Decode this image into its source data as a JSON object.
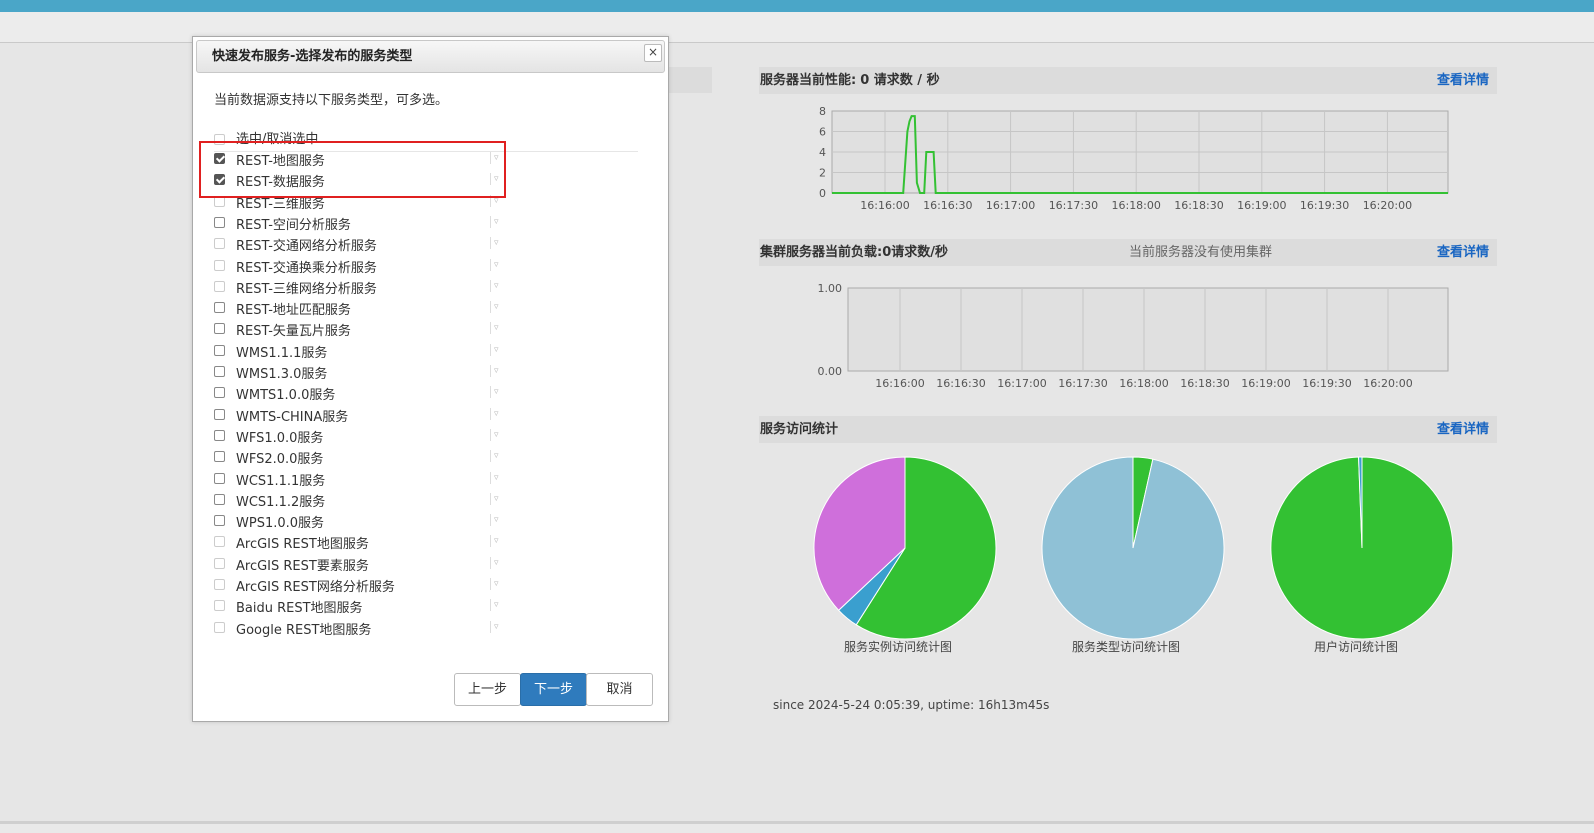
{
  "dialog": {
    "title": "快速发布服务-选择发布的服务类型",
    "close_symbol": "×",
    "description": "当前数据源支持以下服务类型，可多选。",
    "select_all_label": "选中/取消选中",
    "items": [
      {
        "label": "REST-地图服务",
        "checked": true,
        "enabled": true
      },
      {
        "label": "REST-数据服务",
        "checked": true,
        "enabled": true
      },
      {
        "label": "REST-三维服务",
        "checked": false,
        "enabled": false
      },
      {
        "label": "REST-空间分析服务",
        "checked": false,
        "enabled": true
      },
      {
        "label": "REST-交通网络分析服务",
        "checked": false,
        "enabled": false
      },
      {
        "label": "REST-交通换乘分析服务",
        "checked": false,
        "enabled": false
      },
      {
        "label": "REST-三维网络分析服务",
        "checked": false,
        "enabled": false
      },
      {
        "label": "REST-地址匹配服务",
        "checked": false,
        "enabled": true
      },
      {
        "label": "REST-矢量瓦片服务",
        "checked": false,
        "enabled": true
      },
      {
        "label": "WMS1.1.1服务",
        "checked": false,
        "enabled": true
      },
      {
        "label": "WMS1.3.0服务",
        "checked": false,
        "enabled": true
      },
      {
        "label": "WMTS1.0.0服务",
        "checked": false,
        "enabled": true
      },
      {
        "label": "WMTS-CHINA服务",
        "checked": false,
        "enabled": true
      },
      {
        "label": "WFS1.0.0服务",
        "checked": false,
        "enabled": true
      },
      {
        "label": "WFS2.0.0服务",
        "checked": false,
        "enabled": true
      },
      {
        "label": "WCS1.1.1服务",
        "checked": false,
        "enabled": true
      },
      {
        "label": "WCS1.1.2服务",
        "checked": false,
        "enabled": true
      },
      {
        "label": "WPS1.0.0服务",
        "checked": false,
        "enabled": true
      },
      {
        "label": "ArcGIS REST地图服务",
        "checked": false,
        "enabled": false
      },
      {
        "label": "ArcGIS REST要素服务",
        "checked": false,
        "enabled": false
      },
      {
        "label": "ArcGIS REST网络分析服务",
        "checked": false,
        "enabled": false
      },
      {
        "label": "Baidu REST地图服务",
        "checked": false,
        "enabled": false
      },
      {
        "label": "Google REST地图服务",
        "checked": false,
        "enabled": false
      }
    ],
    "buttons": {
      "prev": "上一步",
      "next": "下一步",
      "cancel": "取消"
    }
  },
  "perf_section": {
    "title": "服务器当前性能:",
    "value": "0 请求数 / 秒",
    "detail_link": "查看详情"
  },
  "cluster_section": {
    "title": "集群服务器当前负载:",
    "value": "0请求数/秒",
    "note": "当前服务器没有使用集群",
    "detail_link": "查看详情"
  },
  "stats_section": {
    "title": "服务访问统计",
    "detail_link": "查看详情"
  },
  "pie_labels": [
    "服务实例访问统计图",
    "服务类型访问统计图",
    "用户访问统计图"
  ],
  "since_text": "since 2024-5-24 0:05:39, uptime: 16h13m45s",
  "colors": {
    "green": "#33c133",
    "lightblue": "#8fc1d6",
    "blue": "#3a9fcf",
    "purple": "#cf6fdb",
    "link": "#1a66c2",
    "primary": "#2f7bbd"
  },
  "chart_data": [
    {
      "type": "line",
      "x_ticks": [
        "16:16:00",
        "16:16:30",
        "16:17:00",
        "16:17:30",
        "16:18:00",
        "16:18:30",
        "16:19:00",
        "16:19:30",
        "16:20:00"
      ],
      "y_ticks": [
        "0",
        "2",
        "4",
        "6",
        "8"
      ],
      "ylim": [
        0,
        8
      ],
      "x_seconds_range": [
        0,
        294
      ],
      "points": [
        [
          0,
          0
        ],
        [
          34,
          0
        ],
        [
          36,
          6
        ],
        [
          37,
          7
        ],
        [
          38,
          7.5
        ],
        [
          39.5,
          7.5
        ],
        [
          40.5,
          1
        ],
        [
          42,
          0
        ],
        [
          44,
          0
        ],
        [
          45,
          4
        ],
        [
          48.5,
          4
        ],
        [
          49.5,
          0
        ],
        [
          294,
          0
        ]
      ],
      "series_color": "#33c133"
    },
    {
      "type": "line",
      "x_ticks": [
        "16:16:00",
        "16:16:30",
        "16:17:00",
        "16:17:30",
        "16:18:00",
        "16:18:30",
        "16:19:00",
        "16:19:30",
        "16:20:00"
      ],
      "y_ticks": [
        "0.00",
        "1.00"
      ],
      "ylim": [
        0,
        1
      ],
      "points": []
    },
    {
      "type": "pie",
      "slices": [
        {
          "value": 59,
          "color": "#33c133"
        },
        {
          "value": 4,
          "color": "#3a9fcf"
        },
        {
          "value": 37,
          "color": "#cf6fdb"
        }
      ]
    },
    {
      "type": "pie",
      "slices": [
        {
          "value": 3.5,
          "color": "#33c133"
        },
        {
          "value": 96.5,
          "color": "#8fc1d6"
        }
      ]
    },
    {
      "type": "pie",
      "slices": [
        {
          "value": 99.4,
          "color": "#33c133"
        },
        {
          "value": 0.6,
          "color": "#3a9fcf"
        }
      ]
    }
  ]
}
